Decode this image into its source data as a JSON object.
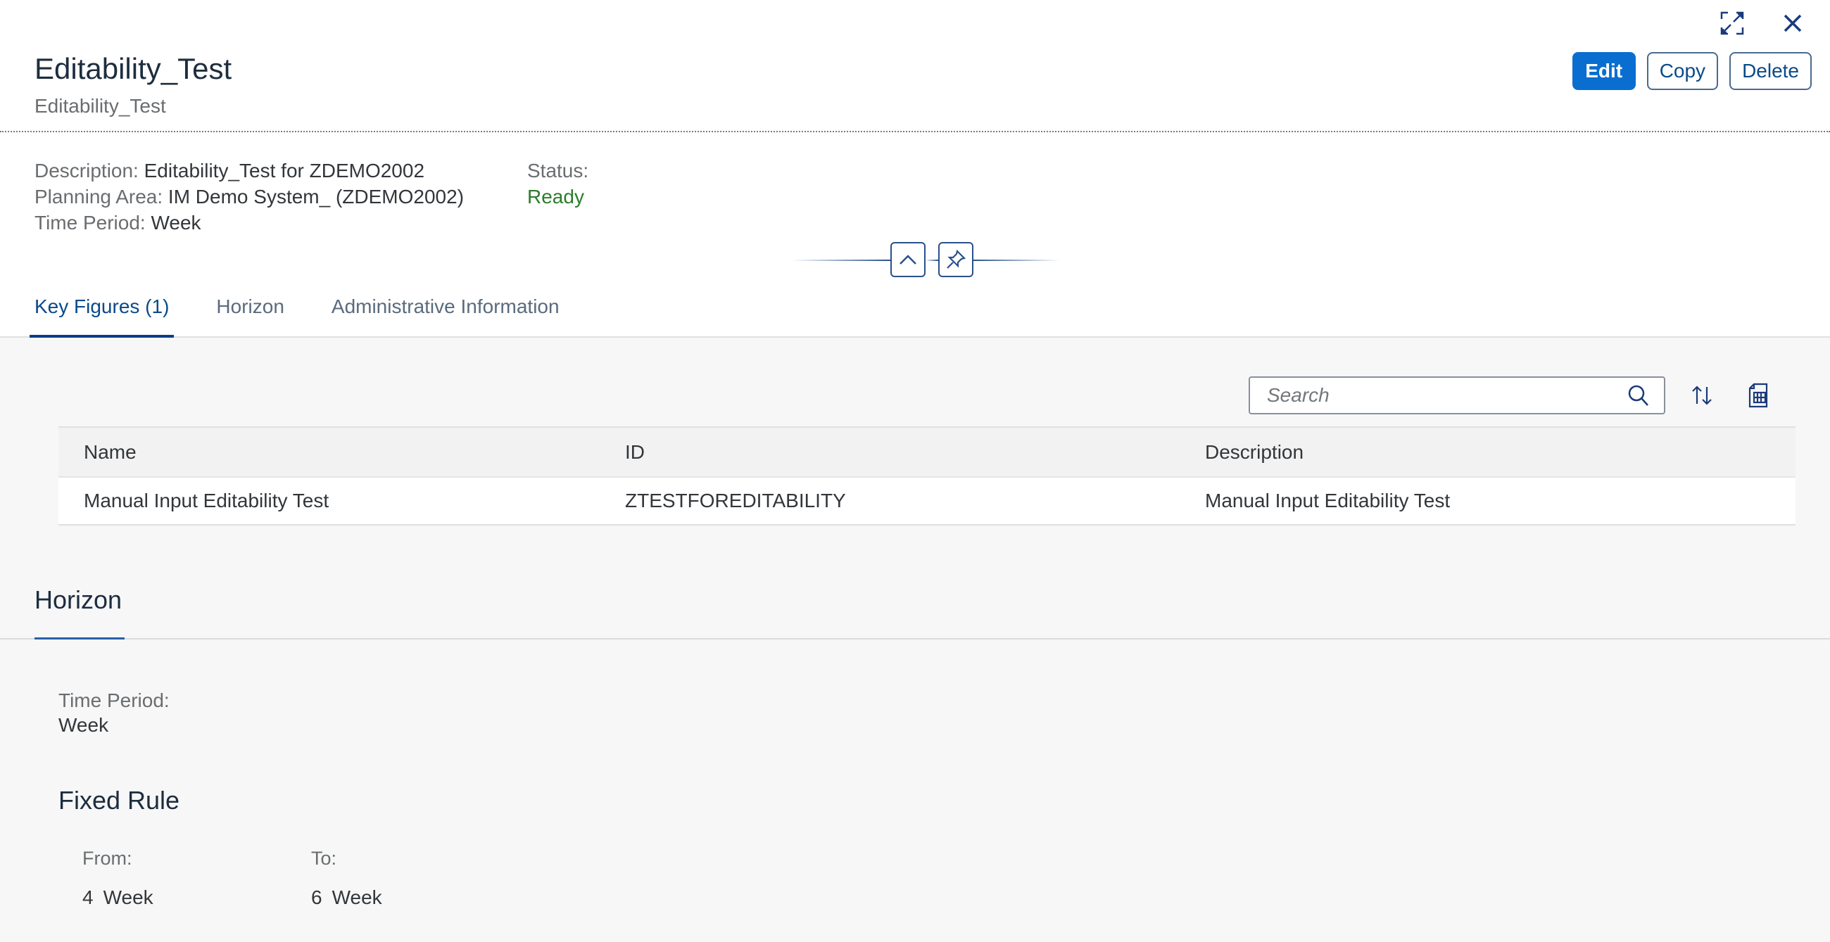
{
  "header": {
    "title": "Editability_Test",
    "subtitle": "Editability_Test",
    "icons": [
      "fullscreen-icon",
      "close-icon"
    ],
    "actions": {
      "edit": "Edit",
      "copy": "Copy",
      "delete": "Delete"
    }
  },
  "info": {
    "description_label": "Description:",
    "description_value": "Editability_Test for ZDEMO2002",
    "planning_area_label": "Planning Area:",
    "planning_area_value": "IM Demo System_ (ZDEMO2002)",
    "time_period_label": "Time Period:",
    "time_period_value": "Week",
    "status_label": "Status:",
    "status_value": "Ready",
    "status_color": "#2b7d2b"
  },
  "tabs": [
    {
      "label": "Key Figures (1)",
      "active": true
    },
    {
      "label": "Horizon",
      "active": false
    },
    {
      "label": "Administrative Information",
      "active": false
    }
  ],
  "key_figures": {
    "search_placeholder": "Search",
    "columns": [
      "Name",
      "ID",
      "Description"
    ],
    "rows": [
      {
        "name": "Manual Input Editability Test",
        "id": "ZTESTFOREDITABILITY",
        "description": "Manual Input Editability Test"
      }
    ]
  },
  "horizon": {
    "title": "Horizon",
    "time_period_label": "Time Period:",
    "time_period_value": "Week",
    "fixed_rule_title": "Fixed Rule",
    "from_label": "From:",
    "from_number": "4",
    "from_unit": "Week",
    "to_label": "To:",
    "to_number": "6",
    "to_unit": "Week"
  },
  "colors": {
    "brand": "#0a6ed1",
    "accent": "#0a3c8c"
  }
}
